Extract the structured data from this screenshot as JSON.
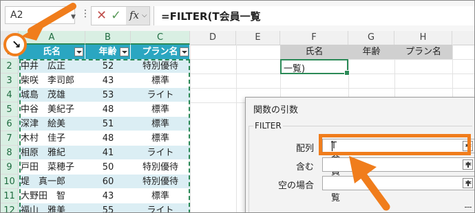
{
  "app": {
    "accent": "#2b8a57",
    "annotation_color": "#f07d1c"
  },
  "name_box": {
    "value": "A2"
  },
  "formula_bar": {
    "cancel_icon": "x-icon",
    "enter_icon": "check-icon",
    "fx_label": "fx",
    "formula": "=FILTER(T会員一覧"
  },
  "columns": [
    "A",
    "B",
    "C",
    "D",
    "E",
    "F",
    "G",
    "H"
  ],
  "rows": [
    "1",
    "2",
    "3",
    "4",
    "5",
    "6",
    "7",
    "8",
    "9",
    "10",
    "11",
    "12"
  ],
  "table": {
    "headers": [
      "氏名",
      "年齢",
      "プラン名"
    ],
    "header_color": "#2aa6c1",
    "band_color": "#dbeef4",
    "records": [
      [
        "中井　広正",
        "52",
        "特別優待"
      ],
      [
        "柴咲　李司郎",
        "43",
        "標準"
      ],
      [
        "城島　茂雄",
        "53",
        "ライト"
      ],
      [
        "中谷　美紀子",
        "48",
        "標準"
      ],
      [
        "深津　絵美",
        "51",
        "標準"
      ],
      [
        "木村　佳子",
        "48",
        "標準"
      ],
      [
        "相原　雅紀",
        "41",
        "ライト"
      ],
      [
        "戸田　菜穂子",
        "50",
        "特別優待"
      ],
      [
        "堤　真一郎",
        "60",
        "特別優待"
      ],
      [
        "大野田　智",
        "43",
        "標準"
      ],
      [
        "福山　雅美",
        "55",
        "ライト"
      ]
    ]
  },
  "output": {
    "headers": [
      "氏名",
      "年齢",
      "プラン名"
    ],
    "f2_value": "一覧)"
  },
  "dialog": {
    "title": "関数の引数",
    "function_name": "FILTER",
    "args": [
      {
        "label": "配列",
        "value": "T会員一覧"
      },
      {
        "label": "含む",
        "value": ""
      },
      {
        "label": "空の場合",
        "value": ""
      }
    ],
    "equals": "="
  },
  "annotations": {
    "corner_marker": "↘"
  }
}
